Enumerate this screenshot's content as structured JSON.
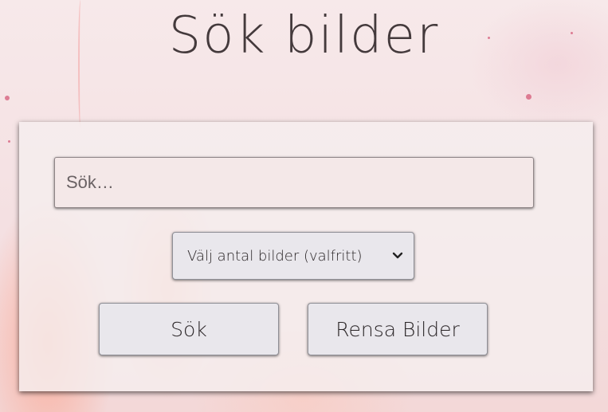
{
  "page": {
    "title": "Sök bilder"
  },
  "search": {
    "placeholder": "Sök…",
    "value": ""
  },
  "count_select": {
    "selected_label": "Välj antal bilder (valfritt)"
  },
  "buttons": {
    "search_label": "Sök",
    "clear_label": "Rensa Bilder"
  },
  "colors": {
    "title_text": "#443a3c",
    "panel_bg": "#f5eeee",
    "button_bg": "#e9e7ec"
  }
}
